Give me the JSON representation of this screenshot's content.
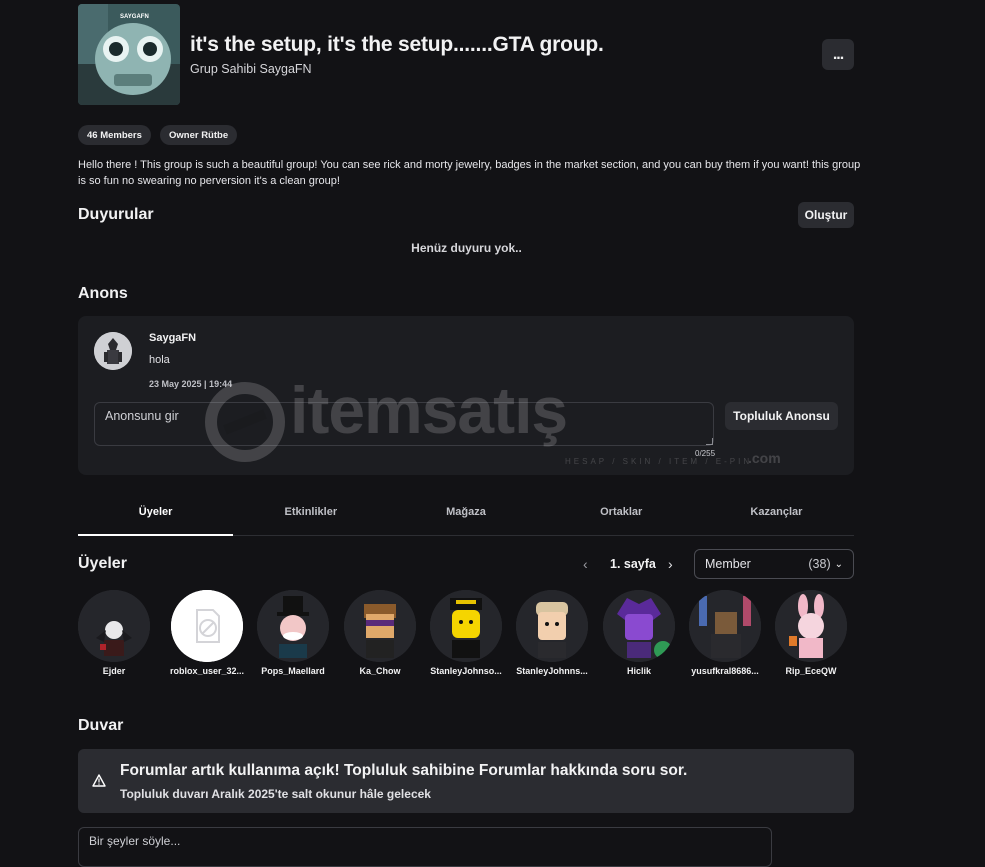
{
  "header": {
    "title": "it's the setup, it's the setup.......GTA group.",
    "owner_line": "Grup Sahibi SaygaFN",
    "thumb_tag": "SAYGAFN",
    "more_label": "..."
  },
  "chips": {
    "members": "46 Members",
    "rank": "Owner Rütbe"
  },
  "description": "Hello there ! This group is such a beautiful group! You can see rick and morty jewelry, badges in the market section, and you can buy them if you want! this group is so fun no swearing no perversion it's a clean group!",
  "announcements": {
    "heading": "Duyurular",
    "create_label": "Oluştur",
    "empty_text": "Henüz duyuru yok.."
  },
  "anons": {
    "heading": "Anons",
    "post": {
      "author": "SaygaFN",
      "text": "hola",
      "date": "23 May 2025 | 19:44"
    },
    "input_placeholder": "Anonsunu gir",
    "counter": "0/255",
    "submit_label": "Topluluk Anonsu"
  },
  "tabs": [
    {
      "label": "Üyeler",
      "active": true
    },
    {
      "label": "Etkinlikler",
      "active": false
    },
    {
      "label": "Mağaza",
      "active": false
    },
    {
      "label": "Ortaklar",
      "active": false
    },
    {
      "label": "Kazançlar",
      "active": false
    }
  ],
  "members_section": {
    "heading": "Üyeler",
    "page_label": "1. sayfa",
    "role_value": "Member",
    "role_count": "(38)",
    "members": [
      {
        "name": "Ejder"
      },
      {
        "name": "roblox_user_32..."
      },
      {
        "name": "Pops_Maellard"
      },
      {
        "name": "Ka_Chow"
      },
      {
        "name": "StanleyJohnso..."
      },
      {
        "name": "StanleyJohnns..."
      },
      {
        "name": "Hiclik"
      },
      {
        "name": "yusufkral8686..."
      },
      {
        "name": "Rip_EceQW"
      }
    ]
  },
  "wall": {
    "heading": "Duvar",
    "alert_title": "Forumlar artık kullanıma açık! Topluluk sahibine Forumlar hakkında soru sor.",
    "alert_subtitle": "Topluluk duvarı Aralık 2025'te salt okunur hâle gelecek",
    "input_placeholder": "Bir şeyler söyle..."
  },
  "watermark": {
    "brand": "itemsatış",
    "tagline": "HESAP / SKIN / ITEM / E-PIN",
    "suffix": ".com"
  },
  "colors": {
    "background": "#121215",
    "panel": "#1c1d21",
    "button": "#2b2c31",
    "text": "#f2f2f3"
  }
}
